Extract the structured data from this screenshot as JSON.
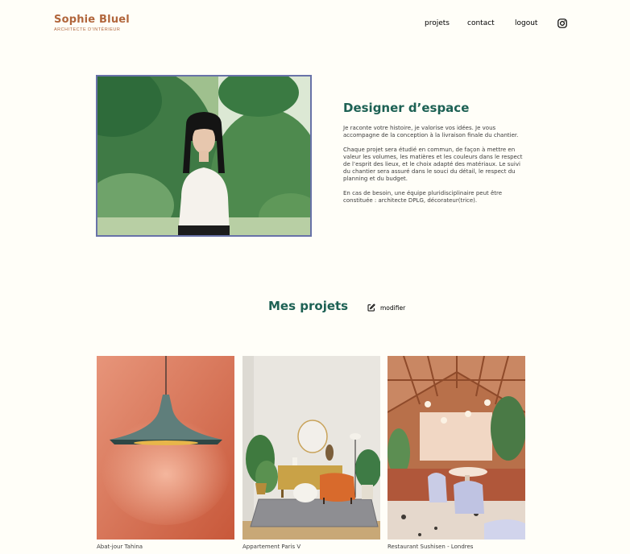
{
  "header": {
    "logo_name": "Sophie Bluel",
    "logo_subtitle": "ARCHITECTE D'INTÉRIEUR",
    "nav": {
      "projets": "projets",
      "contact": "contact",
      "logout": "logout"
    },
    "social_icon": "instagram-icon"
  },
  "introduction": {
    "title": "Designer d’espace",
    "paragraphs": [
      "Je raconte votre histoire, je valorise vos idées. Je vous accompagne de la conception à la livraison finale du chantier.",
      "Chaque projet sera étudié en commun, de façon à mettre en valeur les volumes, les matières et les couleurs dans le respect de l’esprit des lieux, et le choix adapté des matériaux. Le suivi du chantier sera assuré dans le souci du détail, le respect du planning et du budget.",
      "En cas de besoin, une équipe pluridisciplinaire peut être constituée : architecte DPLG, décorateur(trice)."
    ],
    "photo_frame_color": "#6872A8"
  },
  "portfolio": {
    "title": "Mes projets",
    "edit_label": "modifier",
    "edit_icon": "pen-to-square-icon",
    "works": [
      {
        "caption": "Abat-jour Tahina"
      },
      {
        "caption": "Appartement Paris V"
      },
      {
        "caption": "Restaurant Sushisen - Londres"
      }
    ]
  },
  "colors": {
    "brand": "#B1663C",
    "title_green": "#1D6154",
    "background": "#FFFEF8"
  }
}
